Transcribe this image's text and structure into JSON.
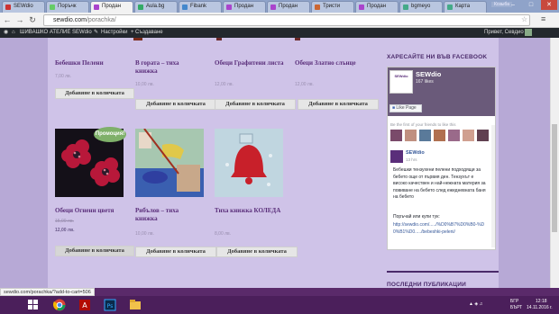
{
  "browser": {
    "tabs": [
      {
        "label": "SEWdio"
      },
      {
        "label": "Поръчк"
      },
      {
        "label": "Продан"
      },
      {
        "label": "Aula.bg"
      },
      {
        "label": "Fibank"
      },
      {
        "label": "Продан"
      },
      {
        "label": "Продан"
      },
      {
        "label": "Тристи"
      },
      {
        "label": "Продан"
      },
      {
        "label": "bgmeyo"
      },
      {
        "label": "Карта"
      }
    ],
    "user": "Козыба",
    "url_host": "sewdio.com",
    "url_path": "/porachka/",
    "status_url": "sewdio.com/porachka/?add-to-cart=506"
  },
  "adminbar": {
    "site": "ШИВАШКО АТЕЛИЕ SEWdio",
    "customize": "Настройки",
    "new": "Създаване",
    "greeting": "Привет, Севдио"
  },
  "products_row1": [
    {
      "title": "Бебешки Пелени",
      "price": "7,00 лв.",
      "button": "Добавяне в количката"
    },
    {
      "title": "В гората – тиха книжка",
      "price": "10,00 лв.",
      "button": "Добавяне в количката"
    },
    {
      "title": "Обеци Графитени листа",
      "price": "12,00 лв.",
      "button": "Добавяне в количката"
    },
    {
      "title": "Обеци Златно слънце",
      "price": "12,00 лв.",
      "button": "Добавяне в количката"
    }
  ],
  "products_row2": [
    {
      "title": "Обеци Огнени цветя",
      "old_price": "15,00 лв.",
      "price": "12,00 лв.",
      "button": "Добавяне в количката",
      "badge": "Промоция!"
    },
    {
      "title": "Рибълов – тиха книжка",
      "price": "10,00 лв.",
      "button": "Добавяне в количката"
    },
    {
      "title": "Тиха книжка КОЛЕДА",
      "price": "8,00 лв.",
      "button": "Добавяне в количката"
    }
  ],
  "sidebar": {
    "facebook_heading": "ХАРЕСАЙТЕ НИ ВЪВ FACEBOOK",
    "fb_page_name": "SEWdio",
    "fb_likes": "167 likes",
    "fb_like_button": "Like Page",
    "fb_friends": "Be the first of your friends to like this",
    "fb_post_author": "SEWdio",
    "fb_post_time": "13 hrs",
    "fb_post_text": "Бебешки тензухени пелени подходящи за бебето още от първия ден. Тензухът е високо качествен и най-нежната материя за повиване на бебето след ежедневната баня на бебето",
    "fb_post_cta": "Поръчай или купи тук:",
    "fb_post_link": "http://sewdio.com/...../%D0%B7%D0%B0-%D0%B1%D0...../bebeshki-peleni/",
    "recent_heading": "ПОСЛЕДНИ ПУБЛИКАЦИИ"
  },
  "taskbar": {
    "lang": "БГР",
    "time": "12:18",
    "date": "14.11.2016 г.",
    "locale": "БЪРТ"
  }
}
